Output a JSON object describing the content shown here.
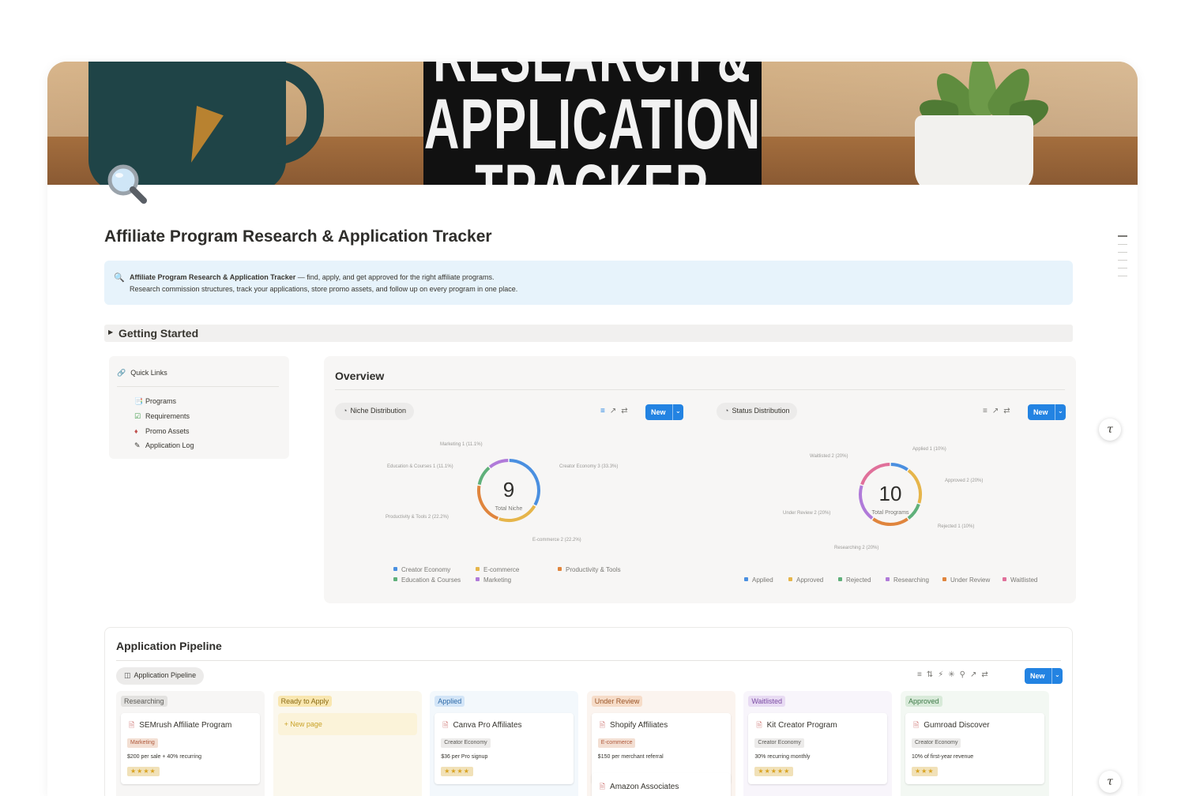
{
  "cover": {
    "sign_line1": "RESEARCH &",
    "sign_line2": "APPLICATION",
    "sign_line3": "TRACKER"
  },
  "page": {
    "title": "Affiliate Program Research & Application Tracker",
    "icon": "magnifier-icon"
  },
  "callout": {
    "bold": "Affiliate Program Research & Application Tracker",
    "line1_rest": " — find, apply, and get approved for the right affiliate programs.",
    "line2": "Research commission structures, track your applications, store promo assets, and follow up on every program in one place."
  },
  "getting_started": {
    "label": "Getting Started"
  },
  "quick_links": {
    "header": "Quick Links",
    "items": [
      {
        "label": "Programs",
        "icon": "programs-icon"
      },
      {
        "label": "Requirements",
        "icon": "requirements-icon"
      },
      {
        "label": "Promo Assets",
        "icon": "promo-assets-icon"
      },
      {
        "label": "Application Log",
        "icon": "application-log-icon"
      }
    ]
  },
  "overview": {
    "title": "Overview",
    "new_label": "New",
    "niche": {
      "view_label": "Niche Distribution",
      "center_value": "9",
      "center_label": "Total Niche"
    },
    "status": {
      "view_label": "Status Distribution",
      "center_value": "10",
      "center_label": "Total Programs"
    }
  },
  "chart_data": [
    {
      "type": "pie",
      "categories": [
        "Creator Economy",
        "E-commerce",
        "Productivity & Tools",
        "Education & Courses",
        "Marketing"
      ],
      "values": [
        3,
        2,
        2,
        1,
        1
      ],
      "labels": [
        "Creator Economy  3 (33.3%)",
        "E-commerce  2 (22.2%)",
        "Productivity & Tools  2 (22.2%)",
        "Education & Courses  1 (11.1%)",
        "Marketing  1 (11.1%)"
      ],
      "colors": [
        "#4a8fe0",
        "#e6b54a",
        "#e0853d",
        "#5fb07a",
        "#b07ad9"
      ],
      "legend": "bottom"
    },
    {
      "type": "pie",
      "categories": [
        "Applied",
        "Approved",
        "Rejected",
        "Under Review",
        "Researching",
        "Waitlisted"
      ],
      "values": [
        1,
        2,
        1,
        2,
        2,
        2
      ],
      "labels": [
        "Applied  1 (10%)",
        "Approved  2 (20%)",
        "Rejected  1 (10%)",
        "Under Review  2 (20%)",
        "Researching  2 (20%)",
        "Waitlisted  2 (20%)"
      ],
      "colors": [
        "#4a8fe0",
        "#e6b54a",
        "#5fb07a",
        "#e0853d",
        "#b07ad9",
        "#e0709a"
      ],
      "legend_order": [
        "Applied",
        "Approved",
        "Rejected",
        "Researching",
        "Under Review",
        "Waitlisted"
      ],
      "legend": "bottom"
    }
  ],
  "pipeline": {
    "title": "Application Pipeline",
    "view_label": "Application Pipeline",
    "new_label": "New",
    "new_page_label": "New page",
    "columns": [
      {
        "tag": "Researching",
        "tag_bg": "#e3e2e0",
        "tag_fg": "#5a5955",
        "bg": "#f7f6f5",
        "card": {
          "title": "SEMrush Affiliate Program",
          "category": "Marketing",
          "cat_bg": "#f3dfd3",
          "cat_fg": "#b05a3c",
          "commission": "$200 per sale + 40% recurring",
          "stars": "★★★★"
        }
      },
      {
        "tag": "Ready to Apply",
        "tag_bg": "#f9e7b0",
        "tag_fg": "#8a6a12",
        "bg": "#fbf8ee",
        "card": null
      },
      {
        "tag": "Applied",
        "tag_bg": "#d3e5f7",
        "tag_fg": "#2d6aa8",
        "bg": "#f3f8fc",
        "card": {
          "title": "Canva Pro Affiliates",
          "category": "Creator Economy",
          "cat_bg": "#ecebea",
          "cat_fg": "#5a5955",
          "commission": "$36 per Pro signup",
          "stars": "★★★★"
        }
      },
      {
        "tag": "Under Review",
        "tag_bg": "#f6dcc8",
        "tag_fg": "#9a5528",
        "bg": "#fbf4ef",
        "card": {
          "title": "Shopify Affiliates",
          "category": "E-commerce",
          "cat_bg": "#f3dfd3",
          "cat_fg": "#b05a3c",
          "commission": "$150 per merchant referral",
          "stars": ""
        },
        "card2": {
          "title": "Amazon Associates"
        }
      },
      {
        "tag": "Waitlisted",
        "tag_bg": "#e8dbf3",
        "tag_fg": "#7a4aa3",
        "bg": "#f8f5fb",
        "card": {
          "title": "Kit Creator Program",
          "category": "Creator Economy",
          "cat_bg": "#ecebea",
          "cat_fg": "#5a5955",
          "commission": "30% recurring monthly",
          "stars": "★★★★★"
        }
      },
      {
        "tag": "Approved",
        "tag_bg": "#d8ead9",
        "tag_fg": "#3e7a48",
        "bg": "#f3f8f3",
        "card": {
          "title": "Gumroad Discover",
          "category": "Creator Economy",
          "cat_bg": "#ecebea",
          "cat_fg": "#5a5955",
          "commission": "10% of first-year revenue",
          "stars": "★★★"
        }
      }
    ]
  }
}
